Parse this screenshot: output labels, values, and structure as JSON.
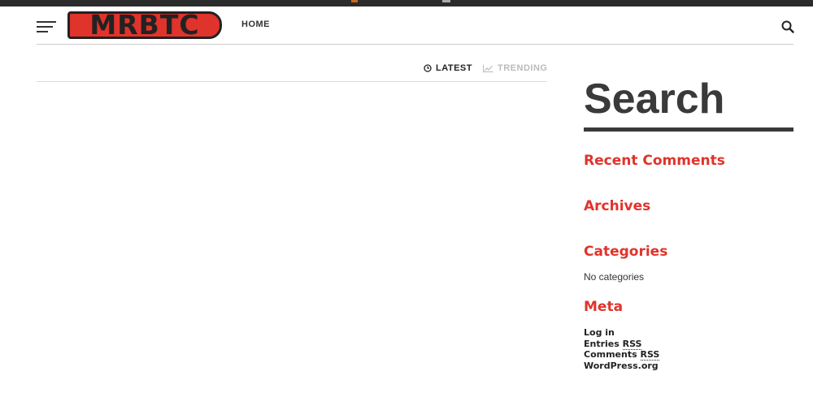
{
  "header": {
    "logo_text": "MRBTC",
    "nav": {
      "home_label": "HOME"
    }
  },
  "tabs": [
    {
      "label": "LATEST",
      "icon": "clock-icon",
      "active": true
    },
    {
      "label": "TRENDING",
      "icon": "trending-up-icon",
      "active": false
    }
  ],
  "sidebar": {
    "search_heading": "Search",
    "recent_comments_title": "Recent Comments",
    "archives_title": "Archives",
    "categories_title": "Categories",
    "categories_empty": "No categories",
    "meta_title": "Meta",
    "meta_links": {
      "log_in": "Log in",
      "entries_prefix": "Entries",
      "comments_prefix": "Comments",
      "rss_abbr": "RSS",
      "wordpress": "WordPress.org"
    }
  },
  "colors": {
    "accent": "#e0332b",
    "text_dark": "#222222",
    "heading_dark": "#3a3a3a",
    "muted": "#bbbbbb",
    "top_strip": "#2b2b2b"
  }
}
